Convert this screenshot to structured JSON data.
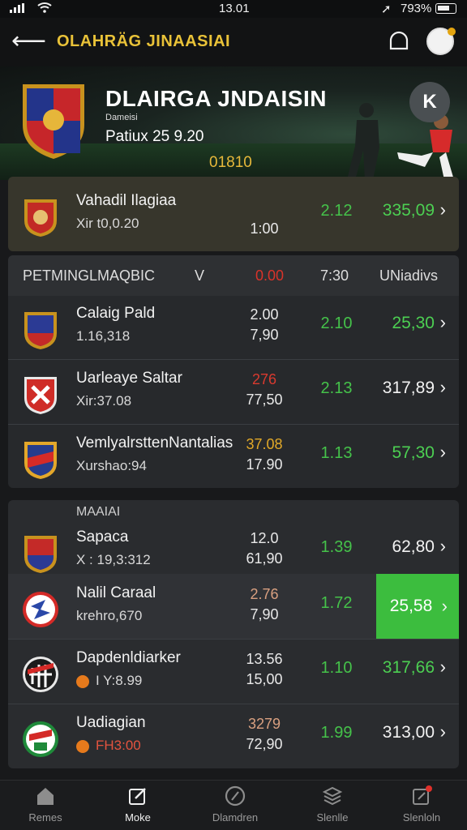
{
  "status": {
    "time": "13.01",
    "battery": "793%"
  },
  "header": {
    "title": "OLAHRÄG JINAASIAI"
  },
  "hero": {
    "league": "DLAIRGA JNDAISIN",
    "sub": "Dameisi",
    "season": "Patiux 25 9.20",
    "code": "01810",
    "close_label": "K"
  },
  "featured": {
    "name": "Vahadil Ilagiaa",
    "meta": "Xir t0,0.20",
    "v1": "",
    "v2": "1:00",
    "odd": "2.12",
    "price": "335,09"
  },
  "columns": {
    "c1": "PETMINGLMAQBIC",
    "c2": "V",
    "c3": "0.00",
    "c4": "7:30",
    "c5": "UNiadivs"
  },
  "matches": [
    {
      "name": "Calaig Pald",
      "meta": "1.16,318",
      "v1": "2.00",
      "v2": "7,90",
      "odd": "2.10",
      "price": "25,30",
      "v1_color": "#e8e8e8"
    },
    {
      "name": "Uarleaye Saltar",
      "meta": "Xir:37.08",
      "v1": "276",
      "v2": "77,50",
      "odd": "2.13",
      "price": "317,89",
      "v1_color": "#d93a2f"
    },
    {
      "name": "VemlyalrsttenNantalias",
      "meta": "Xurshao:94",
      "v1": "37.08",
      "v2": "17.90",
      "odd": "1.13",
      "price": "57,30",
      "v1_color": "#e2a928"
    }
  ],
  "section_label": "MAAIAI",
  "matches2": [
    {
      "name": "Sapaca",
      "meta": "X : 19,3:312",
      "v1": "12.0",
      "v2": "61,90",
      "odd": "1.39",
      "price": "62,80",
      "v1_color": "#e8e8e8"
    },
    {
      "name": "Nalil Caraal",
      "meta": "krehro,670",
      "v1": "2.76",
      "v2": "7,90",
      "odd": "1.72",
      "price": "25,58",
      "v1_color": "#d9a080"
    },
    {
      "name": "Dapdenldiarker",
      "meta": "I Y:8.99",
      "v1": "13.56",
      "v2": "15,00",
      "odd": "1.10",
      "price": "317,66",
      "v1_color": "#e8e8e8"
    },
    {
      "name": "Uadiagian",
      "meta": "FH3:00",
      "v1": "3279",
      "v2": "72,90",
      "odd": "1.99",
      "price": "313,00",
      "v1_color": "#d9a080"
    }
  ],
  "nav": [
    {
      "label": "Remes",
      "icon": "home-icon"
    },
    {
      "label": "Moke",
      "icon": "edit-icon"
    },
    {
      "label": "Dlamdren",
      "icon": "stats-icon"
    },
    {
      "label": "Slenlle",
      "icon": "stack-icon"
    },
    {
      "label": "Slenloln",
      "icon": "notes-icon"
    }
  ]
}
